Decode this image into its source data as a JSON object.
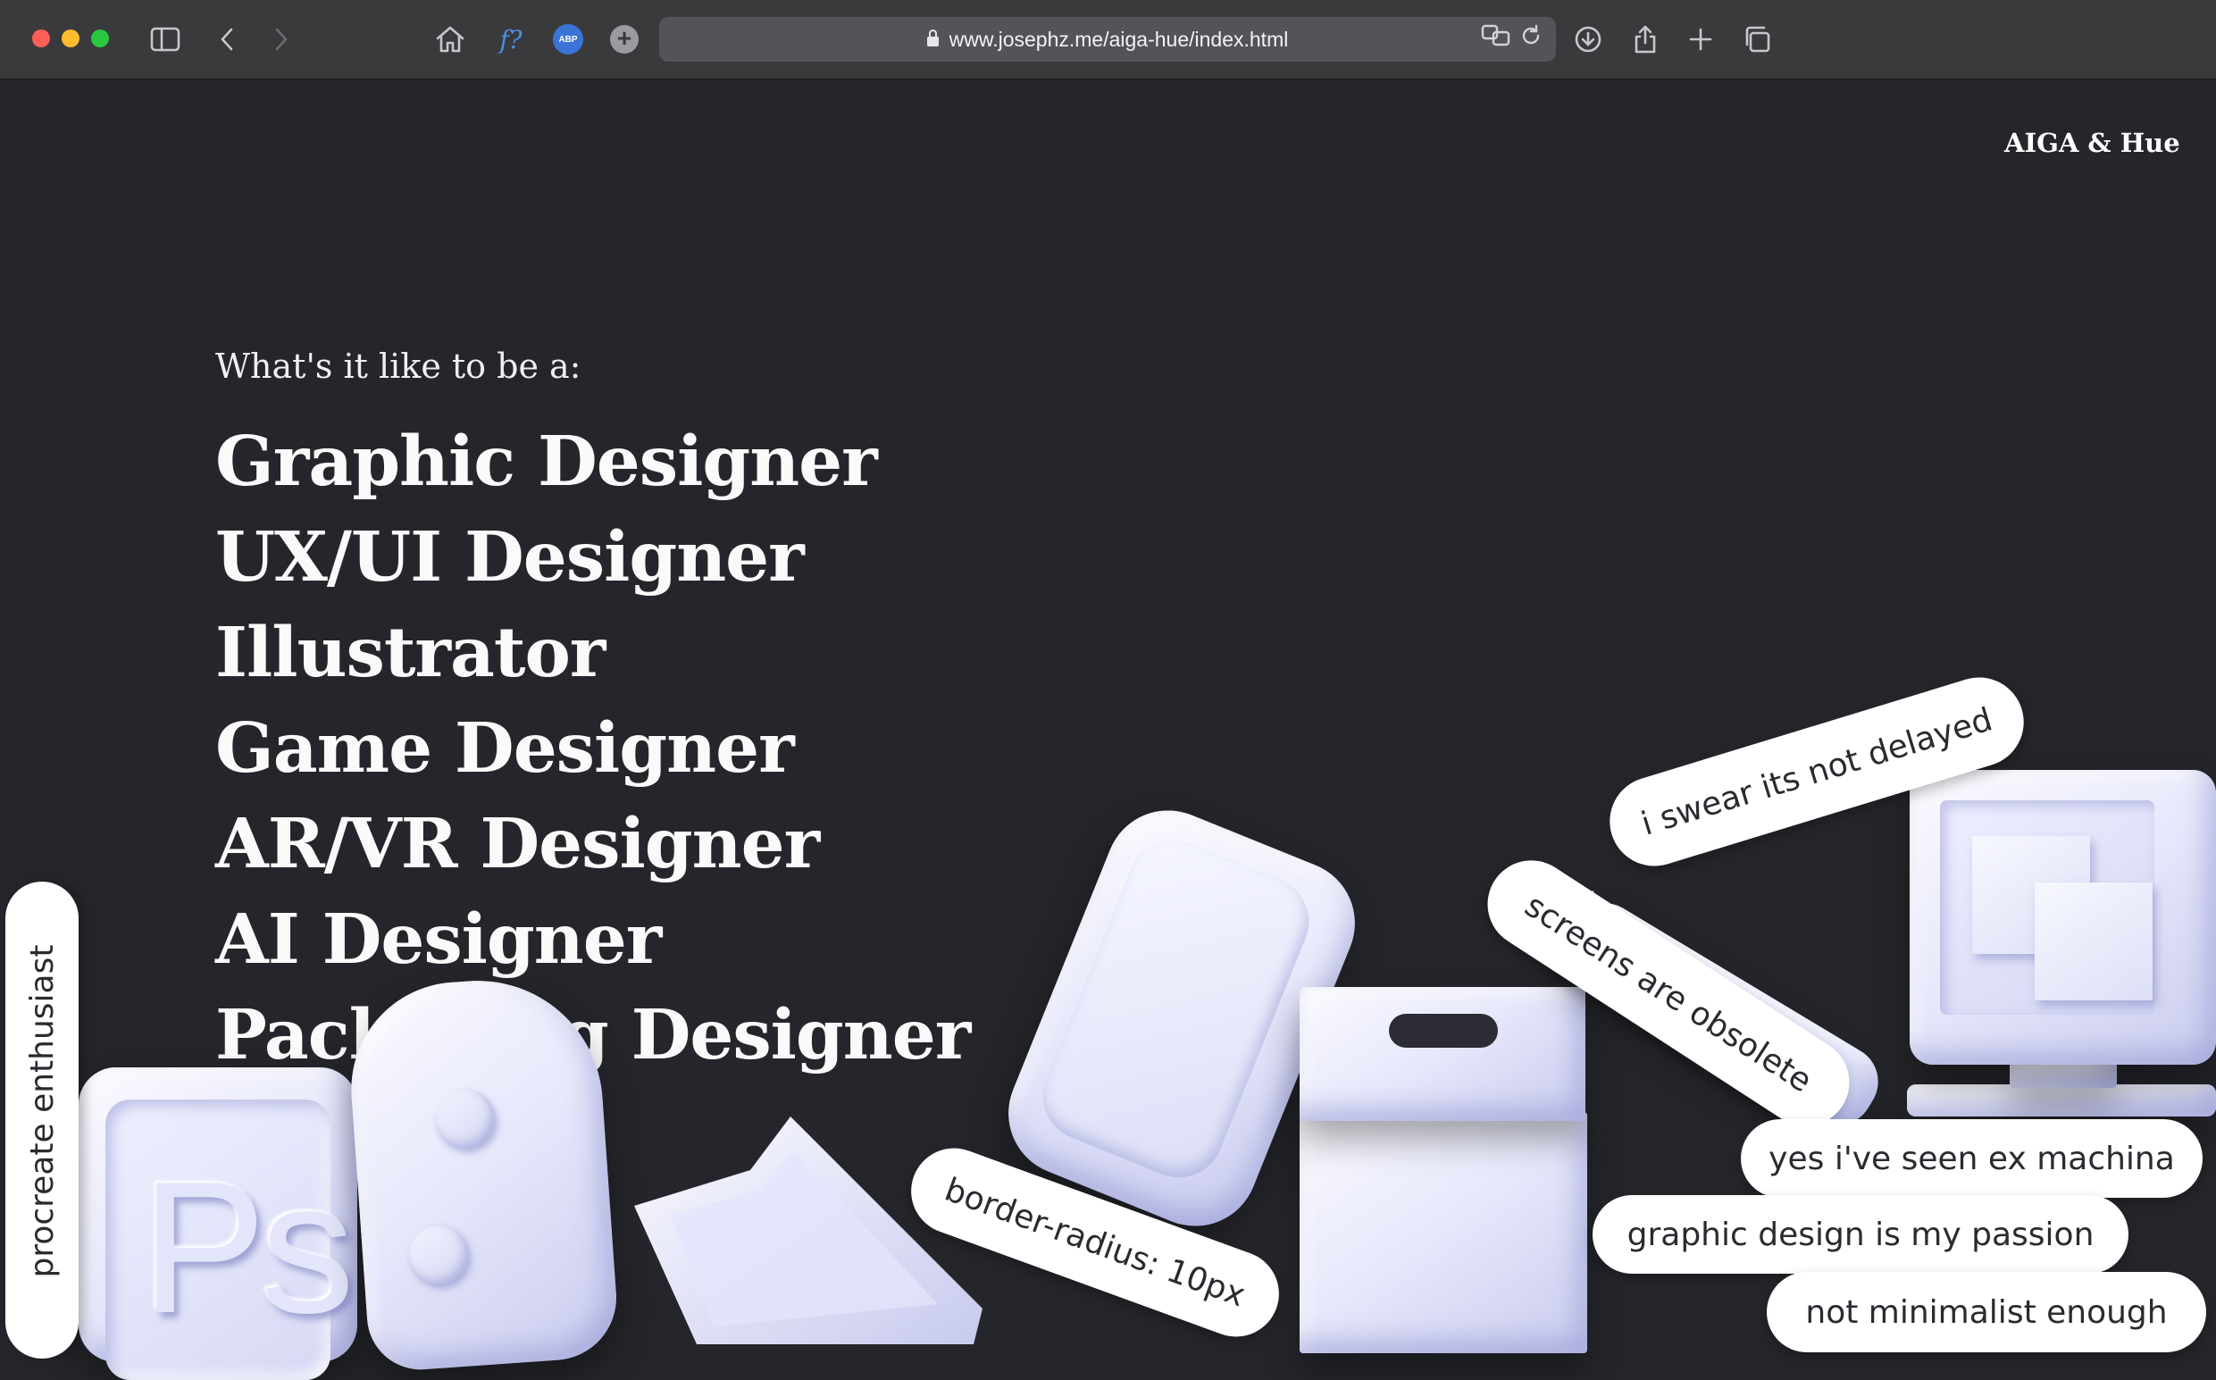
{
  "browser": {
    "url": "www.josephz.me/aiga-hue/index.html",
    "toolbar_icons": [
      "sidebar-icon",
      "back-icon",
      "forward-icon",
      "home-icon",
      "font-finder-icon",
      "adblock-icon",
      "add-extension-icon",
      "translate-icon",
      "reload-icon",
      "download-icon",
      "share-icon",
      "new-tab-icon",
      "tab-overview-icon"
    ],
    "extension_label_f": "f?",
    "extension_label_abp": "ABP"
  },
  "page": {
    "brand": "AIGA & Hue",
    "lede": "What's it like to be a:",
    "roles": [
      "Graphic Designer",
      "UX/UI Designer",
      "Illustrator",
      "Game Designer",
      "AR/VR Designer",
      "AI Designer",
      "Packaging Designer"
    ],
    "stickers": {
      "swear": "i swear its not delayed",
      "screens": "screens are obsolete",
      "border": "border-radius: 10px",
      "exmachina": "yes i've seen ex machina",
      "passion": "graphic design is my passion",
      "minimalist": "not minimalist enough",
      "procreate": "procreate enthusiast"
    },
    "ps_icon_text": "Ps"
  },
  "colors": {
    "background": "#25262b",
    "object": "#e6e7fb",
    "pill": "#ffffff"
  }
}
